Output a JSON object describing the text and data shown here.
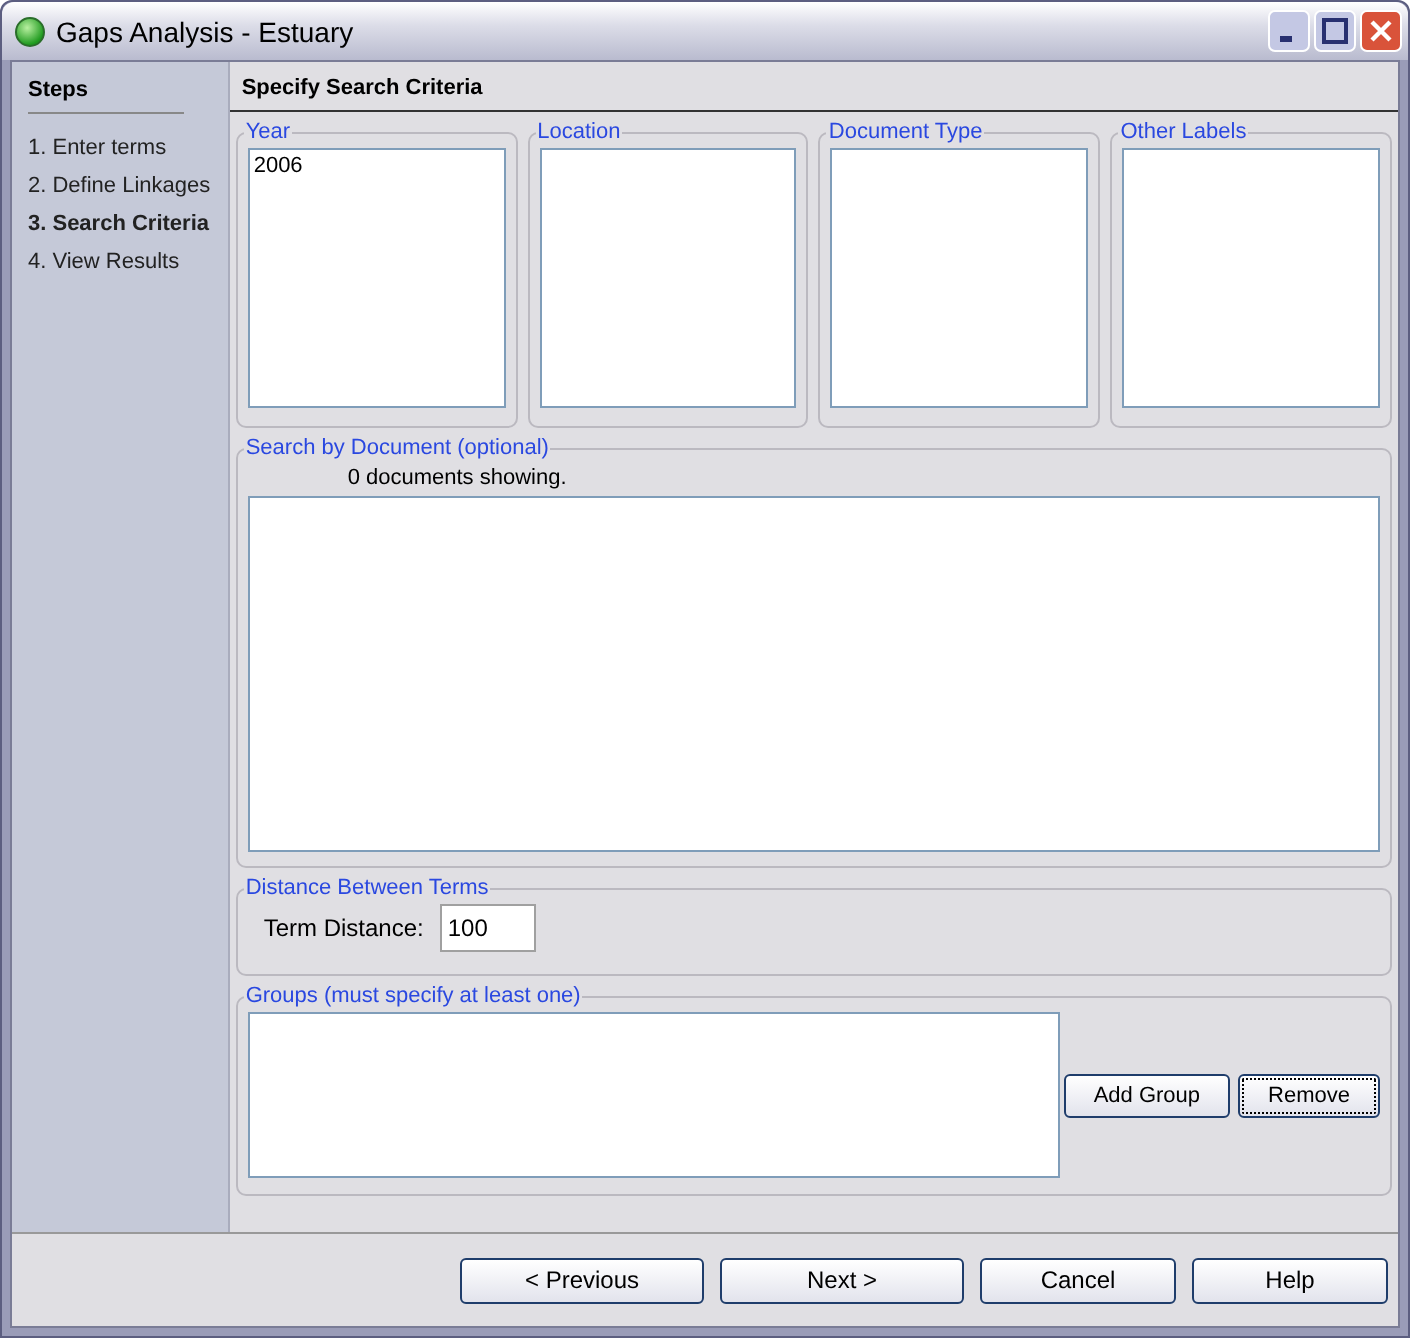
{
  "window": {
    "title": "Gaps Analysis - Estuary"
  },
  "sidebar": {
    "title": "Steps",
    "items": [
      {
        "label": "1. Enter terms",
        "selected": false
      },
      {
        "label": "2. Define Linkages",
        "selected": false
      },
      {
        "label": "3. Search Criteria",
        "selected": true
      },
      {
        "label": "4. View Results",
        "selected": false
      }
    ]
  },
  "header": "Specify Search Criteria",
  "filters": [
    {
      "title": "Year",
      "items": [
        "2006"
      ]
    },
    {
      "title": "Location"
    },
    {
      "title": "Document Type"
    },
    {
      "title": "Other Labels"
    }
  ],
  "search_by_document": {
    "title": "Search by Document (optional)",
    "status": "0 documents showing."
  },
  "distance": {
    "title": "Distance Between Terms",
    "label": "Term Distance:",
    "value": "100"
  },
  "groups": {
    "title": "Groups (must specify at least one)",
    "buttons": [
      {
        "label": "Add Group",
        "focused": false
      },
      {
        "label": "Remove",
        "focused": true
      }
    ]
  },
  "footer_buttons": [
    {
      "label": "< Previous"
    },
    {
      "label": "Next >"
    },
    {
      "label": "Cancel"
    },
    {
      "label": "Help"
    }
  ]
}
